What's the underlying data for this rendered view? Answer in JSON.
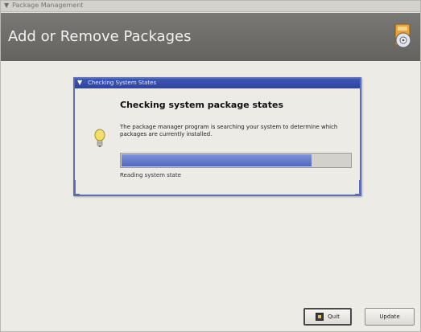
{
  "window": {
    "title": "Package Management"
  },
  "header": {
    "title": "Add or Remove Packages",
    "icon": "package-icon"
  },
  "dialog": {
    "title": "Checking System States",
    "heading": "Checking system package states",
    "description": "The package manager program is searching your system to determine which packages are currently installed.",
    "progress_fraction": 0.83,
    "status": "Reading system state",
    "icon": "lightbulb-icon",
    "accent_color": "#3e56b4"
  },
  "buttons": {
    "quit_label": "Quit",
    "update_label": "Update"
  }
}
